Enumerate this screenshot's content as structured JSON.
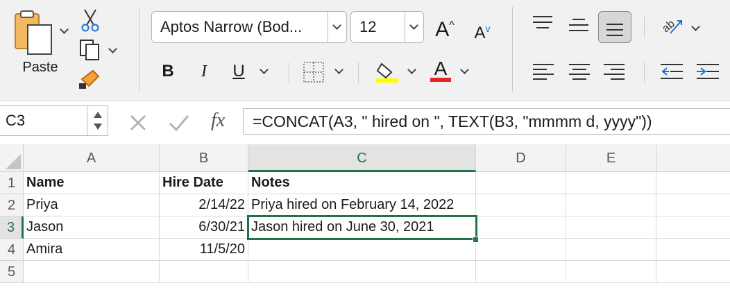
{
  "ribbon": {
    "paste_label": "Paste",
    "font_name": "Aptos Narrow (Bod...",
    "font_size": "12",
    "bold_label": "B",
    "italic_label": "I",
    "underline_label": "U",
    "increase_font_label": "A",
    "decrease_font_label": "A",
    "highlight_color": "#ffff00",
    "font_color": "#e8262a",
    "font_color_letter": "A"
  },
  "formula_bar": {
    "name_box": "C3",
    "fx_label": "fx",
    "formula": "=CONCAT(A3, \" hired on \", TEXT(B3, \"mmmm d, yyyy\"))"
  },
  "sheet": {
    "columns": [
      "A",
      "B",
      "C",
      "D",
      "E"
    ],
    "rows": [
      "1",
      "2",
      "3",
      "4",
      "5"
    ],
    "cells": {
      "A1": "Name",
      "B1": "Hire Date",
      "C1": "Notes",
      "A2": "Priya",
      "B2": "2/14/22",
      "C2": "Priya hired on February 14, 2022",
      "A3": "Jason",
      "B3": "6/30/21",
      "C3": "Jason hired on June 30, 2021",
      "A4": "Amira",
      "B4": "11/5/20"
    },
    "selected_cell": "C3",
    "accent": "#217346"
  }
}
